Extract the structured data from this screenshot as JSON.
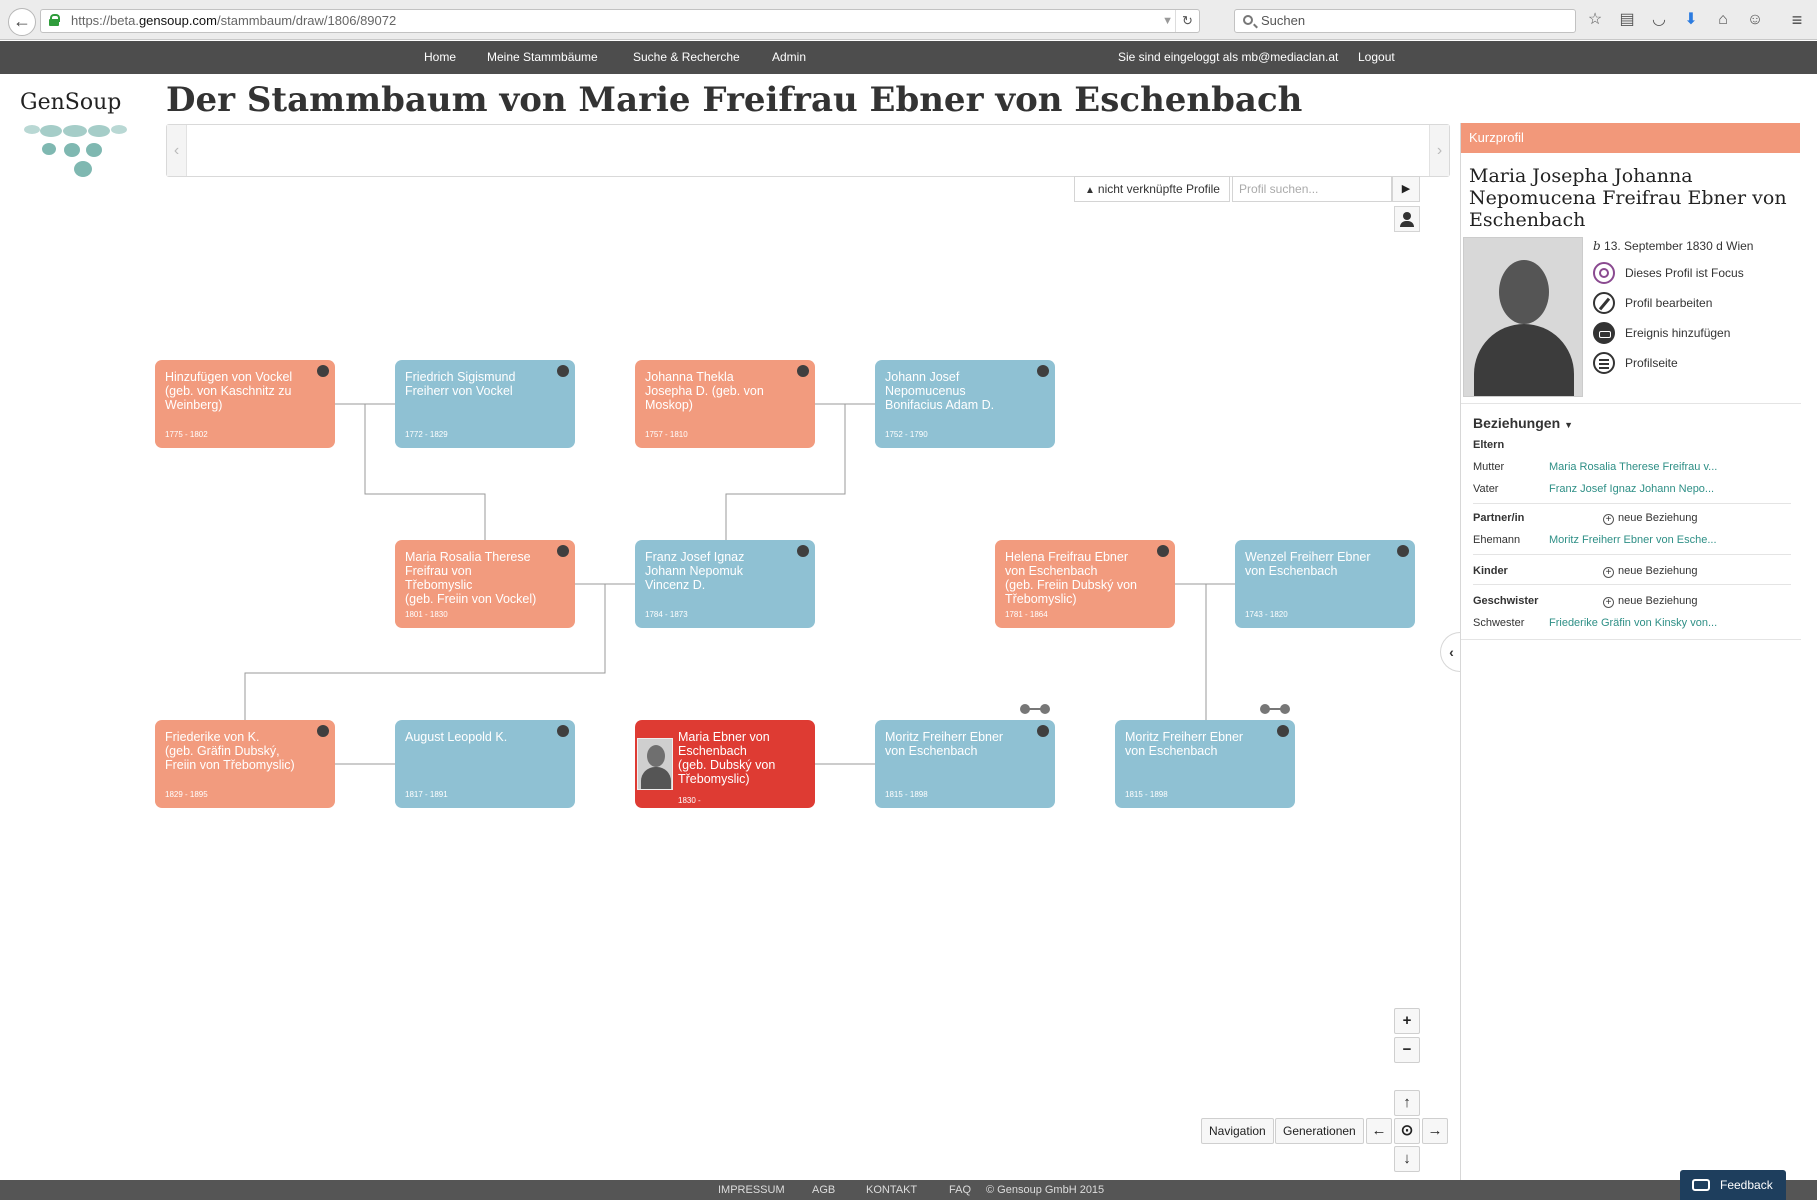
{
  "browser": {
    "url_prefix": "https://beta.",
    "url_host": "gensoup.com",
    "url_path": "/stammbaum/draw/1806/89072",
    "search_placeholder": "Suchen"
  },
  "nav": {
    "home": "Home",
    "my_trees": "Meine Stammbäume",
    "search": "Suche & Recherche",
    "admin": "Admin",
    "logged_in_prefix": "Sie sind eingeloggt als",
    "user": "mb@mediaclan.at",
    "logout": "Logout"
  },
  "logo": {
    "text": "GenSoup"
  },
  "page_title": "Der Stammbaum von Marie Freifrau Ebner von Eschenbach",
  "toolbar": {
    "unlinked_profiles": "nicht verknüpfte Profile",
    "search_placeholder": "Profil suchen..."
  },
  "tree": {
    "nodes": [
      {
        "name": "Hinzufügen von Vockel\n(geb. von Kaschnitz zu\nWeinberg)",
        "years": "1775 - 1802"
      },
      {
        "name": "Friedrich Sigismund\nFreiherr von Vockel",
        "years": "1772 - 1829"
      },
      {
        "name": "Johanna Thekla\nJosepha D. (geb. von\nMoskop)",
        "years": "1757 - 1810"
      },
      {
        "name": "Johann Josef\nNepomucenus\nBonifacius Adam D.",
        "years": "1752 - 1790"
      },
      {
        "name": "Maria Rosalia Therese\nFreifrau von\nTřebomyslic\n(geb. Freiin von Vockel)",
        "years": "1801 - 1830"
      },
      {
        "name": "Franz Josef Ignaz\nJohann Nepomuk\nVincenz D.",
        "years": "1784 - 1873"
      },
      {
        "name": "Helena Freifrau Ebner\nvon Eschenbach\n(geb. Freiin Dubský von\nTřebomyslic)",
        "years": "1781 - 1864"
      },
      {
        "name": "Wenzel Freiherr Ebner\nvon Eschenbach",
        "years": "1743 - 1820"
      },
      {
        "name": "Friederike von K.\n(geb. Gräfin Dubský,\nFreiin von Třebomyslic)",
        "years": "1829 - 1895"
      },
      {
        "name": "August Leopold K.",
        "years": "1817 - 1891"
      },
      {
        "name": "Maria Ebner von\nEschenbach\n(geb. Dubský von\nTřebomyslic)",
        "years": "1830 -"
      },
      {
        "name": "Moritz Freiherr Ebner\nvon Eschenbach",
        "years": "1815 - 1898"
      },
      {
        "name": "Moritz Freiherr Ebner\nvon Eschenbach",
        "years": "1815 - 1898"
      }
    ]
  },
  "controls": {
    "zoom_in": "+",
    "zoom_out": "−",
    "navigation": "Navigation",
    "generations": "Generationen",
    "up": "↑",
    "down": "↓",
    "left": "←",
    "right": "→",
    "center": "⊙"
  },
  "panel": {
    "header": "Kurzprofil",
    "name": "Maria Josepha Johanna Nepomucena Freifrau Ebner von Eschenbach",
    "birth_symbol": "b",
    "birth_text": "13. September 1830 d Wien",
    "actions": {
      "focus": "Dieses Profil ist Focus",
      "edit": "Profil bearbeiten",
      "add_event": "Ereignis hinzufügen",
      "profile_page": "Profilseite"
    },
    "relations": {
      "title": "Beziehungen",
      "parents": "Eltern",
      "mother_label": "Mutter",
      "mother_value": "Maria Rosalia Therese Freifrau v...",
      "father_label": "Vater",
      "father_value": "Franz Josef Ignaz Johann Nepo...",
      "partner_label": "Partner/in",
      "new_relation": "neue Beziehung",
      "husband_label": "Ehemann",
      "husband_value": "Moritz Freiherr Ebner von Esche...",
      "children_label": "Kinder",
      "siblings_label": "Geschwister",
      "sister_label": "Schwester",
      "sister_value": "Friederike Gräfin von Kinsky von..."
    }
  },
  "footer": {
    "impressum": "IMPRESSUM",
    "agb": "AGB",
    "kontakt": "KONTAKT",
    "faq": "FAQ",
    "copyright": "© Gensoup GmbH 2015"
  },
  "feedback": "Feedback",
  "colors": {
    "female": "#f29b7e",
    "male": "#8fc1d3",
    "selected": "#de3b33",
    "nav_bg": "#4d4d4d",
    "link": "#2e8f86"
  }
}
